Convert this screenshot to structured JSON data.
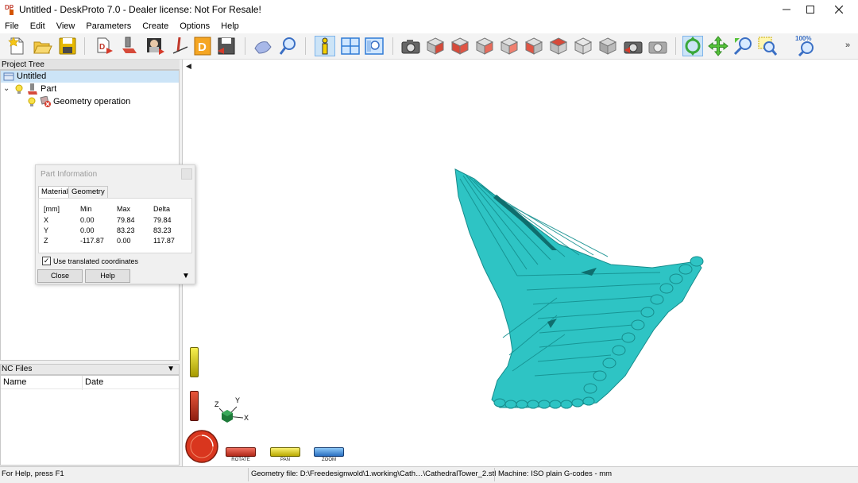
{
  "window": {
    "title": "Untitled - DeskProto 7.0 - Dealer license: Not For Resale!",
    "app_icon": "dp-logo-icon"
  },
  "menu": [
    "File",
    "Edit",
    "View",
    "Parameters",
    "Create",
    "Options",
    "Help"
  ],
  "toolbar": {
    "zoom_label": "100%",
    "icons": [
      "new-project-icon",
      "open-project-icon",
      "save-project-icon",
      "import-geometry-icon",
      "part-parameters-icon",
      "image-icon",
      "vector-icon",
      "drawing-icon",
      "save-geometry-icon",
      "3d-view-icon",
      "search-icon",
      "info-icon",
      "layout-icon",
      "preview-icon",
      "camera-icon",
      "view-cube-icons",
      "rotate-tool-icon",
      "pan-tool-icon",
      "zoom-tool-icon",
      "zoom-window-icon",
      "zoom-100-icon"
    ]
  },
  "project_tree": {
    "header": "Project Tree",
    "items": [
      {
        "label": "Untitled"
      },
      {
        "label": "Part"
      },
      {
        "label": "Geometry operation"
      }
    ]
  },
  "nc_files": {
    "header": "NC Files",
    "columns": [
      "Name",
      "Date"
    ]
  },
  "part_info": {
    "title": "Part Information",
    "tabs": [
      "Material",
      "Geometry"
    ],
    "table": {
      "headers": [
        "[mm]",
        "Min",
        "Max",
        "Delta"
      ],
      "rows": [
        [
          "X",
          "0.00",
          "79.84",
          "79.84"
        ],
        [
          "Y",
          "0.00",
          "83.23",
          "83.23"
        ],
        [
          "Z",
          "-117.87",
          "0.00",
          "117.87"
        ]
      ]
    },
    "checkbox_label": "Use translated coordinates",
    "checkbox_checked": true,
    "close_label": "Close",
    "help_label": "Help"
  },
  "viewport": {
    "axes": {
      "x": "X",
      "y": "Y",
      "z": "Z"
    },
    "model_color": "#2ec4c4",
    "modes": [
      "ROTATE",
      "PAN",
      "ZOOM"
    ]
  },
  "status": {
    "help": "For Help, press F1",
    "geometry_file": "Geometry file: D:\\Freedesignwold\\1.working\\Cath…\\CathedralTower_2.stl",
    "machine": "Machine: ISO plain G-codes - mm"
  }
}
